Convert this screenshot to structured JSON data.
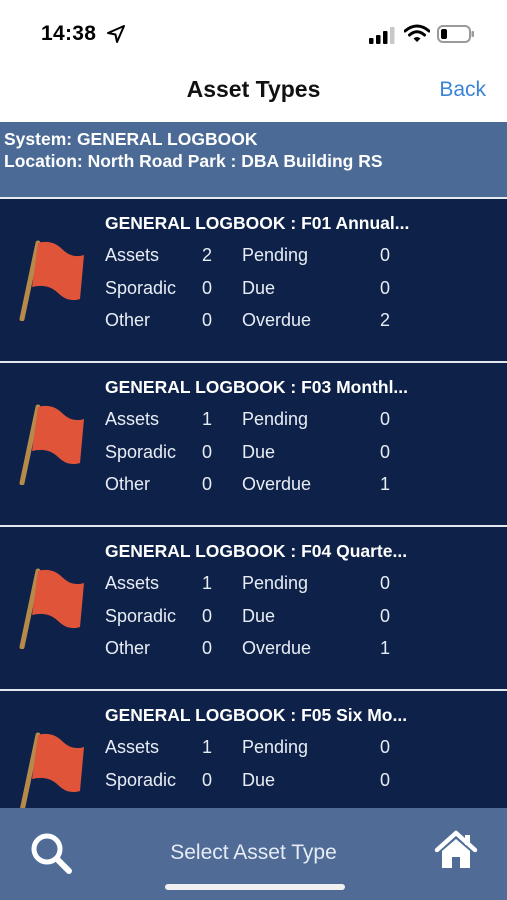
{
  "status_bar": {
    "time": "14:38",
    "icons": [
      "location-arrow-icon",
      "cellular-signal-icon",
      "wifi-icon",
      "battery-icon"
    ]
  },
  "nav": {
    "title": "Asset Types",
    "back_label": "Back"
  },
  "info": {
    "system": "System: GENERAL LOGBOOK",
    "location": "Location: North Road Park : DBA Building RS"
  },
  "labels": {
    "assets": "Assets",
    "sporadic": "Sporadic",
    "other": "Other",
    "pending": "Pending",
    "due": "Due",
    "overdue": "Overdue"
  },
  "items": [
    {
      "title": "GENERAL LOGBOOK : F01 Annual...",
      "assets": "2",
      "sporadic": "0",
      "other": "0",
      "pending": "0",
      "due": "0",
      "overdue": "2"
    },
    {
      "title": "GENERAL LOGBOOK : F03 Monthl...",
      "assets": "1",
      "sporadic": "0",
      "other": "0",
      "pending": "0",
      "due": "0",
      "overdue": "1"
    },
    {
      "title": "GENERAL LOGBOOK : F04 Quarte...",
      "assets": "1",
      "sporadic": "0",
      "other": "0",
      "pending": "0",
      "due": "0",
      "overdue": "1"
    },
    {
      "title": "GENERAL LOGBOOK : F05 Six Mo...",
      "assets": "1",
      "sporadic": "0",
      "pending": "0",
      "due": "0"
    }
  ],
  "bottom_bar": {
    "title": "Select Asset Type",
    "icons": [
      "search-icon",
      "home-icon"
    ]
  },
  "colors": {
    "accent": "#3a84d6",
    "header_bg": "#4b6a96",
    "list_bg": "#0e2249",
    "flag": "#e0553a",
    "pole": "#b58a4a"
  }
}
